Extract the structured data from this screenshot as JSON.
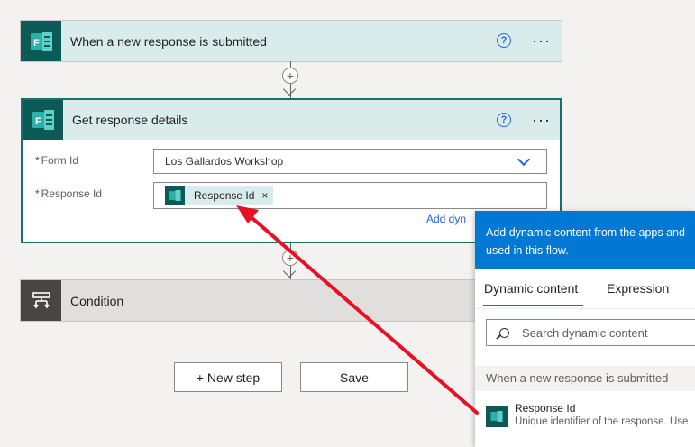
{
  "flow": {
    "trigger": {
      "title": "When a new response is submitted",
      "help": "?",
      "more": "···"
    },
    "action": {
      "title": "Get response details",
      "help": "?",
      "more": "···",
      "form_id": {
        "required_mark": "*",
        "label": "Form Id",
        "value": "Los Gallardos Workshop"
      },
      "response_id": {
        "required_mark": "*",
        "label": "Response Id",
        "token_label": "Response Id",
        "token_close": "×"
      },
      "add_dynamic_link": "Add dyn"
    },
    "condition": {
      "title": "Condition"
    },
    "connector_plus": "+"
  },
  "footer": {
    "new_step": "+ New step",
    "save": "Save"
  },
  "dynamic_panel": {
    "header_line1": "Add dynamic content from the apps and",
    "header_line2": "used in this flow.",
    "tabs": [
      {
        "label": "Dynamic content"
      },
      {
        "label": "Expression"
      }
    ],
    "search": {
      "placeholder": "Search dynamic content"
    },
    "section_title": "When a new response is submitted",
    "items": [
      {
        "title": "Response Id",
        "description": "Unique identifier of the response. Use"
      }
    ]
  },
  "colors": {
    "forms_teal": "#0b5a57",
    "header_bg": "#d9eceb",
    "accent_blue": "#0078d4",
    "arrow_red": "#e81123"
  },
  "icons": {
    "forms": "forms-icon",
    "condition": "condition-icon",
    "help": "help-icon",
    "more": "more-icon",
    "search": "search-icon",
    "chevron": "chevron-down-icon"
  }
}
